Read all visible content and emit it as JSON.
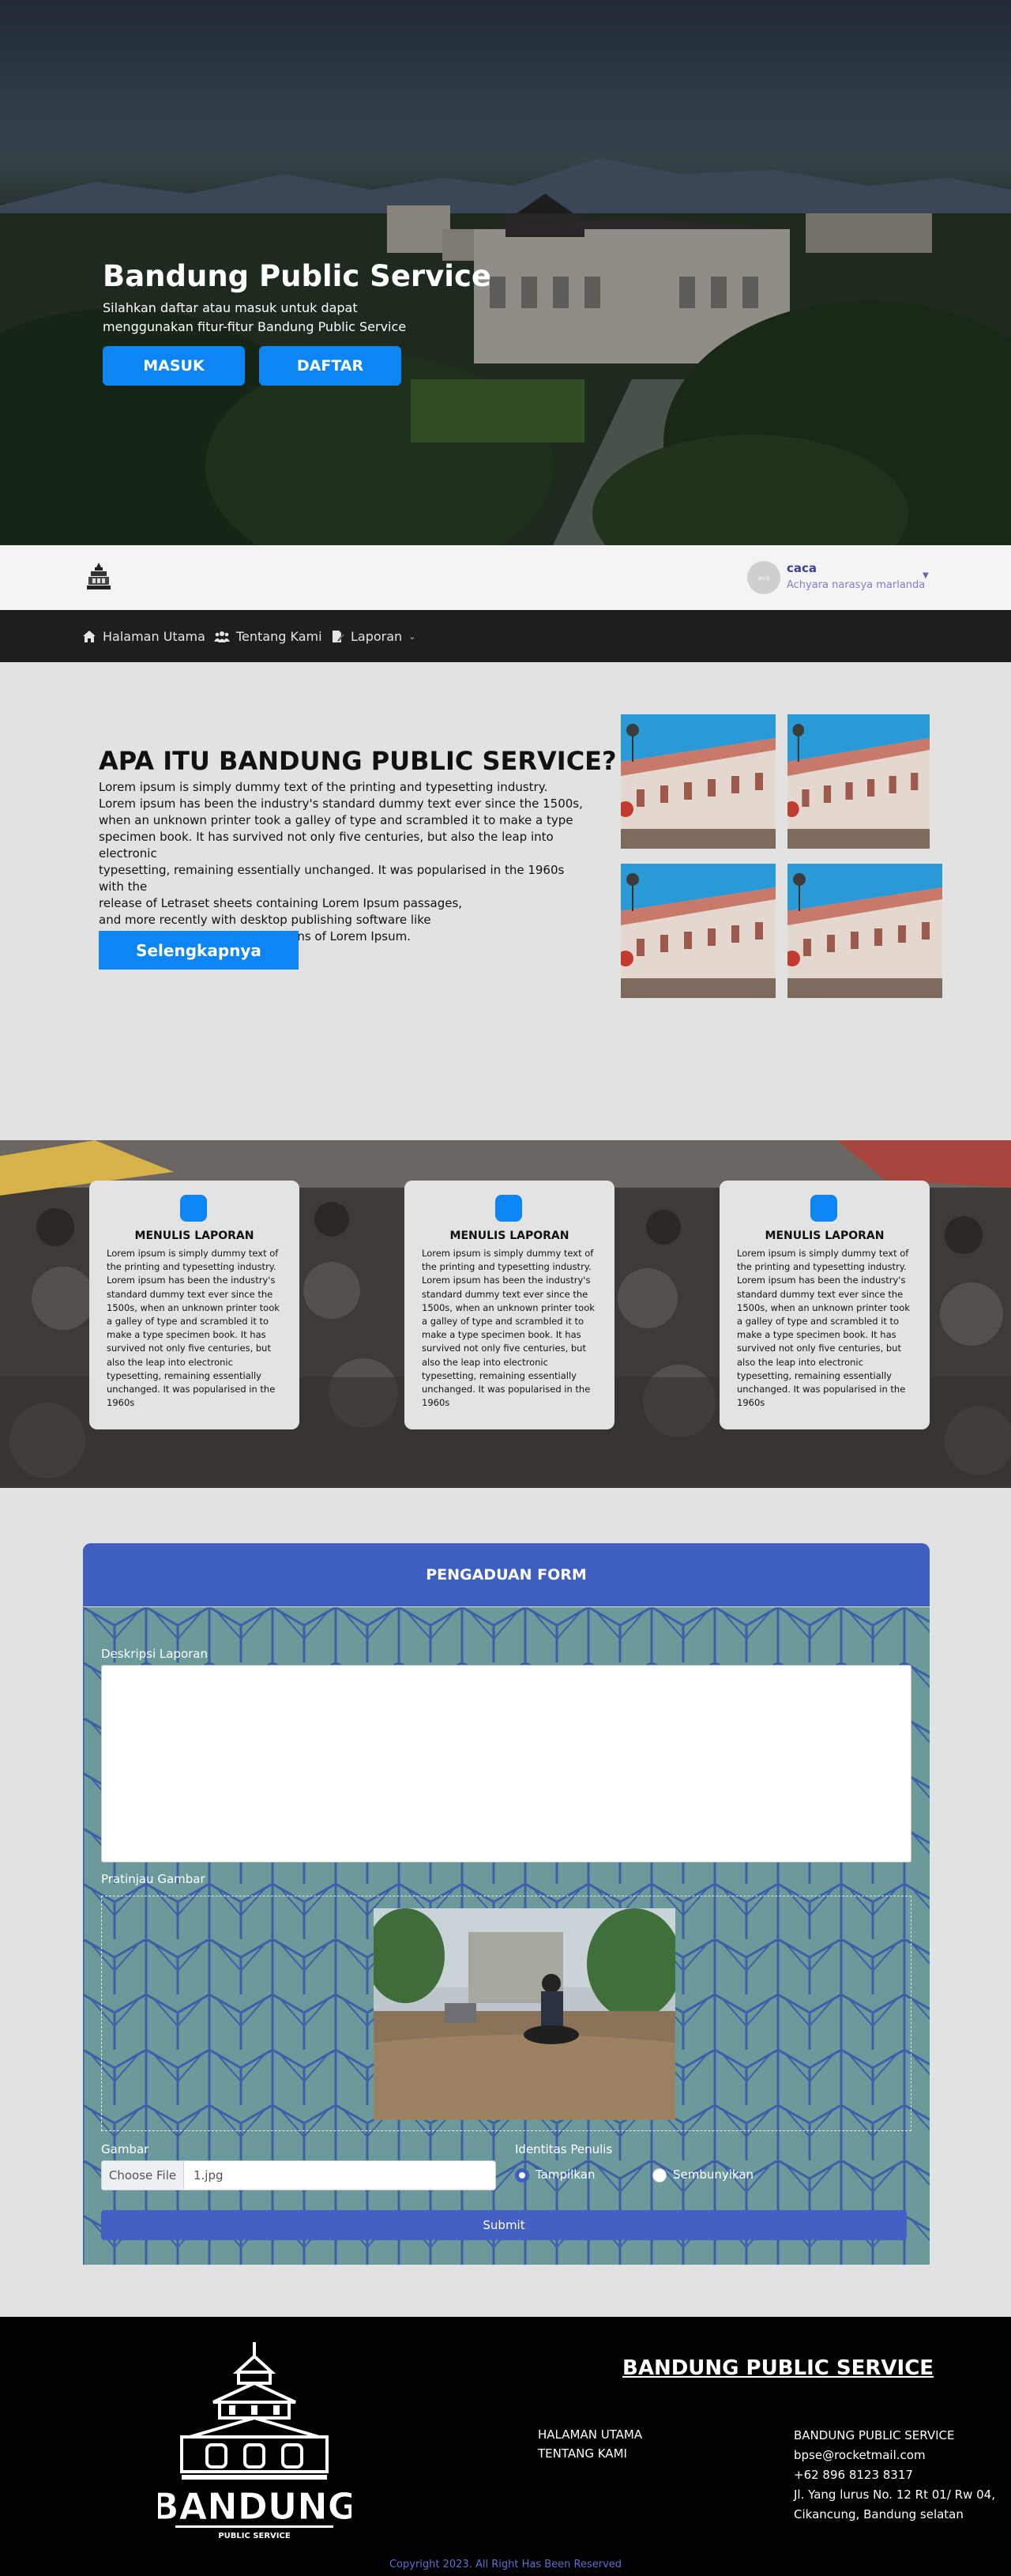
{
  "hero": {
    "title": "Bandung Public Service",
    "subtitle": "Silahkan daftar atau masuk untuk dapat menggunakan fitur-fitur Bandung Public Service",
    "login_label": "MASUK",
    "register_label": "DAFTAR"
  },
  "topbar": {
    "avatar_alt": "ava",
    "user_name": "caca",
    "user_fullname": "Achyara narasya marlanda"
  },
  "nav": {
    "items": [
      {
        "label": "Halaman Utama",
        "icon": "home-icon"
      },
      {
        "label": "Tentang Kami",
        "icon": "users-icon"
      },
      {
        "label": "Laporan",
        "icon": "edit-document-icon"
      }
    ]
  },
  "about": {
    "title": "APA ITU BANDUNG PUBLIC SERVICE?",
    "text": "Lorem ipsum is simply dummy text of the printing and typesetting industry.\nLorem ipsum has been the industry's standard dummy text ever since the 1500s,\nwhen an unknown printer took a galley of type and scrambled it to make a type\n specimen book. It has survived not only five centuries, but also the leap into electronic\n typesetting, remaining essentially unchanged. It was popularised in the 1960s with the\n release of Letraset sheets containing Lorem Ipsum passages,\nand more recently with desktop publishing software like\nAldus PageMaker including versions of Lorem Ipsum.",
    "button_label": "Selengkapnya"
  },
  "cards": [
    {
      "title": "MENULIS LAPORAN",
      "text": "Lorem ipsum is simply dummy text of the printing and typesetting industry. Lorem ipsum has been the industry's standard dummy text ever since the 1500s, when an unknown printer took a galley of type and scrambled it to make a type specimen book. It has survived not only five centuries, but also the leap into electronic typesetting, remaining essentially unchanged. It was popularised in the 1960s"
    },
    {
      "title": "MENULIS LAPORAN",
      "text": "Lorem ipsum is simply dummy text of the printing and typesetting industry. Lorem ipsum has been the industry's standard dummy text ever since the 1500s, when an unknown printer took a galley of type and scrambled it to make a type specimen book. It has survived not only five centuries, but also the leap into electronic typesetting, remaining essentially unchanged. It was popularised in the 1960s"
    },
    {
      "title": "MENULIS LAPORAN",
      "text": "Lorem ipsum is simply dummy text of the printing and typesetting industry. Lorem ipsum has been the industry's standard dummy text ever since the 1500s, when an unknown printer took a galley of type and scrambled it to make a type specimen book. It has survived not only five centuries, but also the leap into electronic typesetting, remaining essentially unchanged. It was popularised in the 1960s"
    }
  ],
  "form": {
    "title": "PENGADUAN FORM",
    "description_label": "Deskripsi Laporan",
    "description_value": "",
    "preview_label": "Pratinjau Gambar",
    "image_label": "Gambar",
    "choose_file_label": "Choose File",
    "file_name": "1.jpg",
    "identity_label": "Identitas Penulis",
    "option_show": "Tampilkan",
    "option_hide": "Sembunyikan",
    "selected_option": "Tampilkan",
    "submit_label": "Submit"
  },
  "footer": {
    "logo_text": "BANDUNG",
    "logo_subtext": "PUBLIC SERVICE",
    "title": "BANDUNG PUBLIC SERVICE",
    "links": [
      "HALAMAN UTAMA",
      "TENTANG KAMI"
    ],
    "contact": {
      "name": "BANDUNG PUBLIC SERVICE",
      "email": "bpse@rocketmail.com",
      "phone": "+62 896 8123 8317",
      "address": "Jl. Yang lurus No. 12 Rt 01/ Rw 04, Cikancung, Bandung selatan"
    },
    "copyright": "Copyright 2023. All Right Has Been Reserved"
  },
  "colors": {
    "primary": "#0d85f5",
    "form_header": "#3f5fbf",
    "nav_bg": "#1e1e1e",
    "footer_bg": "#000000",
    "copyright": "#5c6fd1"
  }
}
